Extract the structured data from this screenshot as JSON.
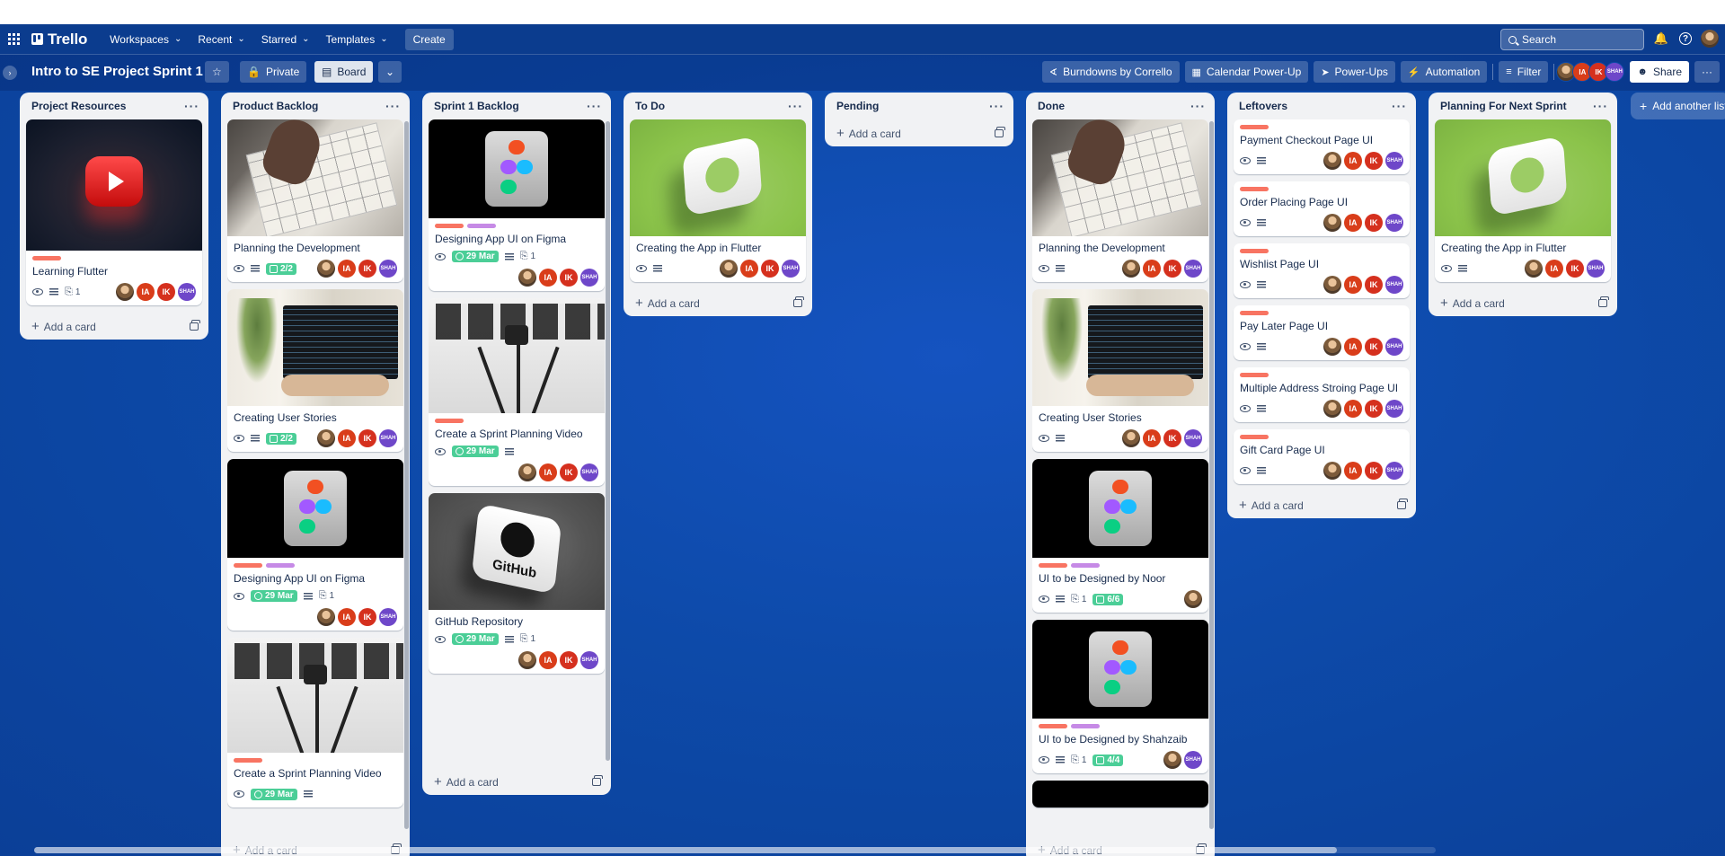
{
  "topnav": {
    "logo": "Trello",
    "menu": [
      {
        "label": "Workspaces"
      },
      {
        "label": "Recent"
      },
      {
        "label": "Starred"
      },
      {
        "label": "Templates"
      }
    ],
    "create_label": "Create",
    "search_placeholder": "Search"
  },
  "board": {
    "title": "Intro to SE Project Sprint 1",
    "visibility_label": "Private",
    "view_label": "Board",
    "powerups": [
      {
        "label": "Burndowns by Corrello",
        "icon": "burndown-icon"
      },
      {
        "label": "Calendar Power-Up",
        "icon": "calendar-icon"
      },
      {
        "label": "Power-Ups",
        "icon": "rocket-icon"
      },
      {
        "label": "Automation",
        "icon": "bolt-icon"
      },
      {
        "label": "Filter",
        "icon": "filter-icon"
      }
    ],
    "members": [
      "IA",
      "IK",
      "SHAH"
    ],
    "share_label": "Share",
    "add_list_label": "Add another list"
  },
  "colors": {
    "label_red": "#f87462",
    "label_purple": "#c68ae6",
    "badge_green": "#4bce97",
    "av_ia": "#d93d1a",
    "av_ik": "#d5301e",
    "av_shah": "#6e47c9"
  },
  "lists": [
    {
      "title": "Project Resources",
      "add_label": "Add a card",
      "cards": [
        {
          "cover": "youtube",
          "labels": [
            "red"
          ],
          "title": "Learning Flutter",
          "watch": true,
          "desc": true,
          "attach": "1",
          "members": [
            "photo",
            "IA",
            "IK",
            "SHAH"
          ]
        }
      ]
    },
    {
      "title": "Product Backlog",
      "add_label": "Add a card",
      "cards": [
        {
          "cover": "sketch",
          "labels": [],
          "title": "Planning the Development",
          "watch": true,
          "desc": true,
          "check": "2/2",
          "members": [
            "photo",
            "IA",
            "IK",
            "SHAH"
          ]
        },
        {
          "cover": "laptop",
          "labels": [],
          "title": "Creating User Stories",
          "watch": true,
          "desc": true,
          "check": "2/2",
          "members": [
            "photo",
            "IA",
            "IK",
            "SHAH"
          ]
        },
        {
          "cover": "figma",
          "labels": [
            "red",
            "purple"
          ],
          "title": "Designing App UI on Figma",
          "watch": true,
          "due": "29 Mar",
          "desc": true,
          "attach": "1",
          "members": [
            "photo",
            "IA",
            "IK",
            "SHAH"
          ]
        },
        {
          "cover": "tripod",
          "labels": [
            "red"
          ],
          "title": "Create a Sprint Planning Video",
          "watch": true,
          "due": "29 Mar",
          "desc": true,
          "members": []
        }
      ]
    },
    {
      "title": "Sprint 1 Backlog",
      "add_label": "Add a card",
      "cards": [
        {
          "cover": "figma",
          "labels": [
            "red",
            "purple"
          ],
          "title": "Designing App UI on Figma",
          "watch": true,
          "due": "29 Mar",
          "desc": true,
          "attach": "1",
          "members": [
            "photo",
            "IA",
            "IK",
            "SHAH"
          ]
        },
        {
          "cover": "tripod",
          "labels": [
            "red"
          ],
          "title": "Create a Sprint Planning Video",
          "watch": true,
          "due": "29 Mar",
          "desc": true,
          "members": [
            "photo",
            "IA",
            "IK",
            "SHAH"
          ]
        },
        {
          "cover": "github",
          "labels": [],
          "title": "GitHub Repository",
          "watch": true,
          "due": "29 Mar",
          "desc": true,
          "attach": "1",
          "members": [
            "photo",
            "IA",
            "IK",
            "SHAH"
          ]
        }
      ]
    },
    {
      "title": "To Do",
      "add_label": "Add a card",
      "cards": [
        {
          "cover": "green",
          "labels": [],
          "title": "Creating the App in Flutter",
          "watch": true,
          "desc": true,
          "members": [
            "photo",
            "IA",
            "IK",
            "SHAH"
          ]
        }
      ]
    },
    {
      "title": "Pending",
      "add_label": "Add a card",
      "cards": []
    },
    {
      "title": "Done",
      "add_label": "Add a card",
      "cards": [
        {
          "cover": "sketch",
          "labels": [],
          "title": "Planning the Development",
          "watch": true,
          "desc": true,
          "members": [
            "photo",
            "IA",
            "IK",
            "SHAH"
          ]
        },
        {
          "cover": "laptop",
          "labels": [],
          "title": "Creating User Stories",
          "watch": true,
          "desc": true,
          "members": [
            "photo",
            "IA",
            "IK",
            "SHAH"
          ]
        },
        {
          "cover": "figma",
          "labels": [
            "red",
            "purple"
          ],
          "title": "UI to be Designed by Noor",
          "watch": true,
          "desc": true,
          "attach": "1",
          "check": "6/6",
          "members": [
            "photo"
          ]
        },
        {
          "cover": "figma",
          "labels": [
            "red",
            "purple"
          ],
          "title": "UI to be Designed by Shahzaib",
          "watch": true,
          "desc": true,
          "attach": "1",
          "check": "4/4",
          "members": [
            "photo",
            "SHAH"
          ]
        },
        {
          "cover": "dark-partial",
          "labels": [],
          "title": "",
          "members": []
        }
      ]
    },
    {
      "title": "Leftovers",
      "add_label": "Add a card",
      "cards": [
        {
          "labels": [
            "red"
          ],
          "title": "Payment Checkout Page UI",
          "watch": true,
          "desc": true,
          "members": [
            "photo",
            "IA",
            "IK",
            "SHAH"
          ]
        },
        {
          "labels": [
            "red"
          ],
          "title": "Order Placing Page UI",
          "watch": true,
          "desc": true,
          "members": [
            "photo",
            "IA",
            "IK",
            "SHAH"
          ]
        },
        {
          "labels": [
            "red"
          ],
          "title": "Wishlist Page UI",
          "watch": true,
          "desc": true,
          "members": [
            "photo",
            "IA",
            "IK",
            "SHAH"
          ]
        },
        {
          "labels": [
            "red"
          ],
          "title": "Pay Later Page UI",
          "watch": true,
          "desc": true,
          "members": [
            "photo",
            "IA",
            "IK",
            "SHAH"
          ]
        },
        {
          "labels": [
            "red"
          ],
          "title": "Multiple Address Stroing Page UI",
          "watch": true,
          "desc": true,
          "members": [
            "photo",
            "IA",
            "IK",
            "SHAH"
          ]
        },
        {
          "labels": [
            "red"
          ],
          "title": "Gift Card Page UI",
          "watch": true,
          "desc": true,
          "members": [
            "photo",
            "IA",
            "IK",
            "SHAH"
          ]
        }
      ]
    },
    {
      "title": "Planning For Next Sprint",
      "add_label": "Add a card",
      "cards": [
        {
          "cover": "green",
          "labels": [],
          "title": "Creating the App in Flutter",
          "watch": true,
          "desc": true,
          "members": [
            "photo",
            "IA",
            "IK",
            "SHAH"
          ]
        }
      ]
    }
  ]
}
